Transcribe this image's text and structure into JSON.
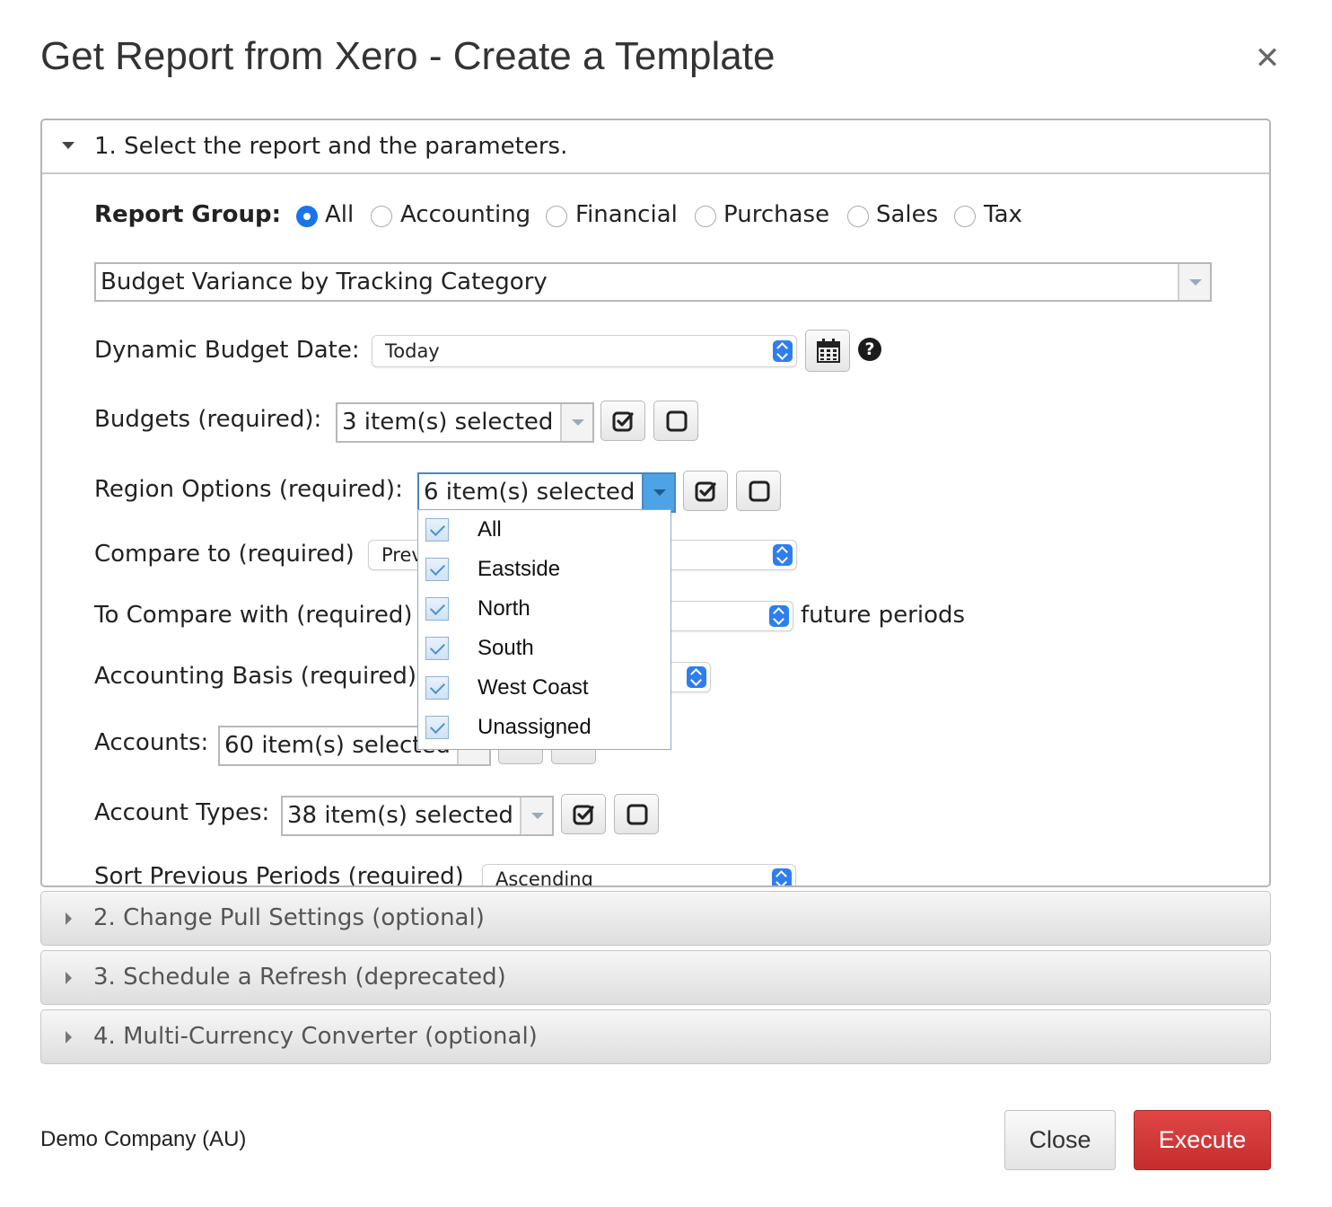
{
  "dialog": {
    "title": "Get Report from Xero - Create a Template",
    "close_icon": "close-icon"
  },
  "section1": {
    "header": "1. Select the report and the parameters.",
    "report_group": {
      "label": "Report Group:",
      "options": [
        "All",
        "Accounting",
        "Financial",
        "Purchase",
        "Sales",
        "Tax"
      ],
      "selected": "All"
    },
    "report_select": {
      "value": "Budget Variance by Tracking Category"
    },
    "dynamic_budget_date": {
      "label": "Dynamic Budget Date:",
      "value": "Today"
    },
    "budgets": {
      "label": "Budgets (required):",
      "value": "3 item(s) selected"
    },
    "region_options": {
      "label": "Region Options (required):",
      "value": "6 item(s) selected",
      "dropdown_items": [
        "All",
        "Eastside",
        "North",
        "South",
        "West Coast",
        "Unassigned"
      ]
    },
    "compare_to": {
      "label": "Compare to (required)",
      "value": "Prev"
    },
    "to_compare_with": {
      "label": "To Compare with (required)",
      "suffix": "future periods"
    },
    "accounting_basis": {
      "label": "Accounting Basis (required)"
    },
    "accounts": {
      "label": "Accounts:",
      "value": "60 item(s) selected"
    },
    "account_types": {
      "label": "Account Types:",
      "value": "38 item(s) selected"
    },
    "sort_previous_periods": {
      "label": "Sort Previous Periods (required)",
      "value": "Ascending"
    }
  },
  "sections": [
    {
      "label": "2. Change Pull Settings (optional)"
    },
    {
      "label": "3. Schedule a Refresh (deprecated)"
    },
    {
      "label": "4. Multi-Currency Converter (optional)"
    }
  ],
  "footer": {
    "company": "Demo Company (AU)",
    "close_label": "Close",
    "execute_label": "Execute"
  },
  "colors": {
    "accent_blue": "#1a73e8",
    "execute_red": "#d63b3b"
  }
}
